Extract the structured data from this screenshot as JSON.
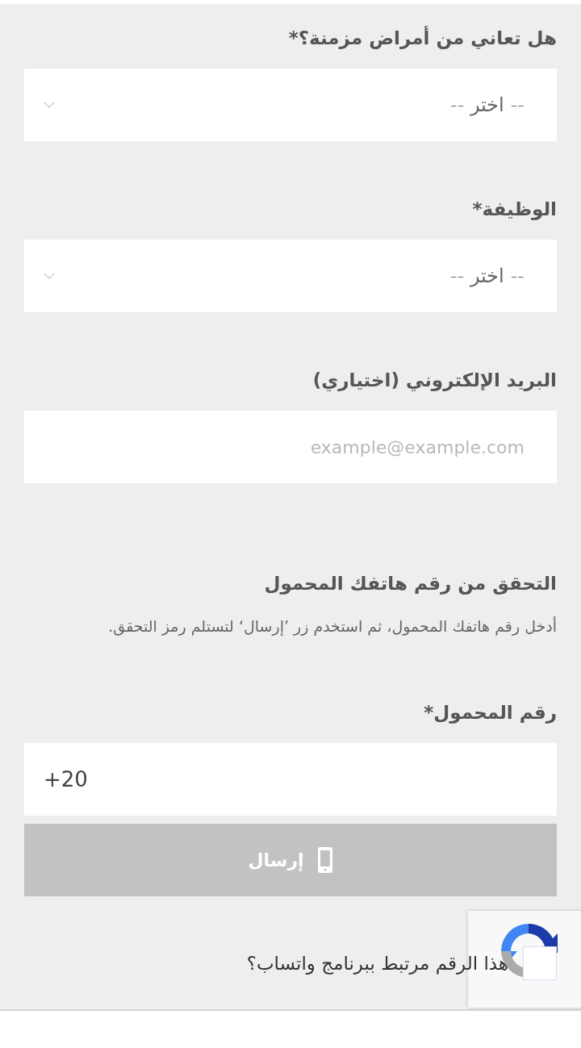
{
  "fields": [
    {
      "kind": "select",
      "label": "هل تعاني من أمراض مزمنة؟*",
      "value": "-- اختر --"
    },
    {
      "kind": "select",
      "label": "الوظيفة*",
      "value": "-- اختر --"
    },
    {
      "kind": "text",
      "label": "البريد الإلكتروني (اختياري)",
      "placeholder": "example@example.com"
    }
  ],
  "verification": {
    "heading": "التحقق من رقم هاتفك المحمول",
    "description": "أدخل رقم هاتفك المحمول، ثم استخدم زر ’إرسال‘ لتستلم رمز التحقق.",
    "phone_label": "رقم المحمول*",
    "phone_value": "+20",
    "send_button": {
      "label": "إرسال",
      "disabled": true
    },
    "whatsapp": {
      "label": "هذا الرقم مرتبط ببرنامج واتساب؟",
      "checked": false
    }
  }
}
